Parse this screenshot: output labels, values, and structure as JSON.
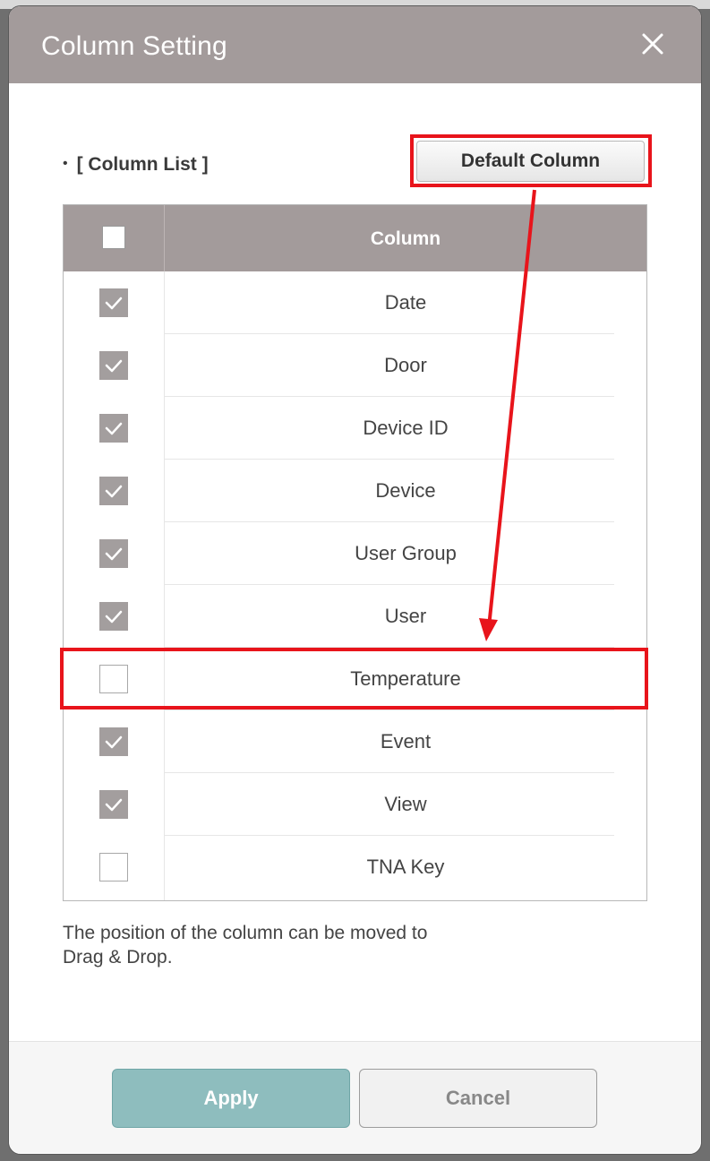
{
  "dialog": {
    "title": "Column Setting",
    "close_icon": "close-icon"
  },
  "column_list": {
    "label": "[ Column List ]",
    "bullet": "•",
    "default_button_label": "Default Column",
    "header": {
      "select_all_checked": false,
      "column_title": "Column"
    },
    "rows": [
      {
        "label": "Date",
        "checked": true
      },
      {
        "label": "Door",
        "checked": true
      },
      {
        "label": "Device ID",
        "checked": true
      },
      {
        "label": "Device",
        "checked": true
      },
      {
        "label": "User Group",
        "checked": true
      },
      {
        "label": "User",
        "checked": true
      },
      {
        "label": "Temperature",
        "checked": false
      },
      {
        "label": "Event",
        "checked": true
      },
      {
        "label": "View",
        "checked": true
      },
      {
        "label": "TNA Key",
        "checked": false
      }
    ]
  },
  "note": {
    "line1": "The position of the column can be moved to",
    "line2": "Drag & Drop."
  },
  "footer": {
    "apply_label": "Apply",
    "cancel_label": "Cancel"
  },
  "colors": {
    "header_bg": "#a39b9b",
    "highlight": "#e8141b",
    "apply_bg": "#8ebdbe",
    "checked_bg": "#a39e9e"
  }
}
